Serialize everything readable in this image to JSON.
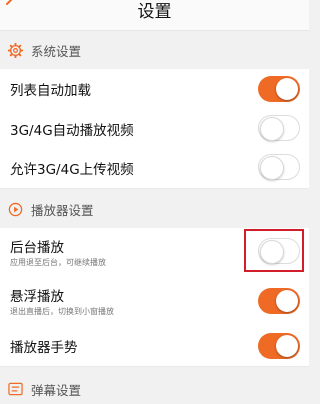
{
  "header": {
    "title": "设置"
  },
  "colors": {
    "accent": "#ef6a25",
    "highlight_box": "#d21e2a"
  },
  "sections": [
    {
      "title": "系统设置",
      "icon": "gear-icon",
      "items": [
        {
          "label": "列表自动加载",
          "on": true
        },
        {
          "label": "3G/4G自动播放视频",
          "on": false
        },
        {
          "label": "允许3G/4G上传视频",
          "on": false
        }
      ]
    },
    {
      "title": "播放器设置",
      "icon": "play-circle-icon",
      "items": [
        {
          "label": "后台播放",
          "sublabel": "应用退至后台，可继续播放",
          "on": false,
          "highlighted": true
        },
        {
          "label": "悬浮播放",
          "sublabel": "退出直播后，切换到小窗播放",
          "on": true
        },
        {
          "label": "播放器手势",
          "on": true
        }
      ]
    },
    {
      "title": "弹幕设置",
      "icon": "danmaku-list-icon",
      "items": []
    }
  ]
}
